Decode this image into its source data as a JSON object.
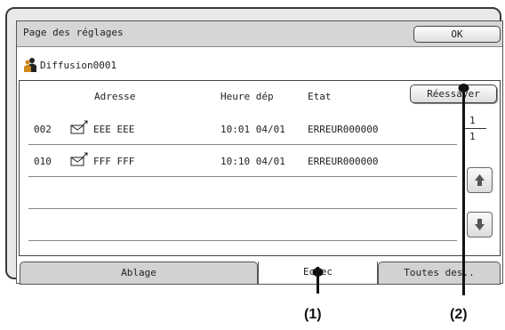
{
  "window": {
    "title": "Page des réglages",
    "ok_label": "OK"
  },
  "job": {
    "name": "Diffusion0001",
    "icon": "broadcast-people-icon"
  },
  "list": {
    "headers": {
      "address": "Adresse",
      "time": "Heure dép",
      "status": "Etat"
    },
    "retry_label": "Réessayer",
    "rows": [
      {
        "number": "002",
        "icon": "email-icon",
        "address": "EEE EEE",
        "time": "10:01 04/01",
        "status": "ERREUR000000"
      },
      {
        "number": "010",
        "icon": "email-icon",
        "address": "FFF FFF",
        "time": "10:10 04/01",
        "status": "ERREUR000000"
      }
    ],
    "page_current": "1",
    "page_total": "1"
  },
  "tabs": [
    {
      "label": "Ablage",
      "active": false
    },
    {
      "label": "Echec",
      "active": true
    },
    {
      "label": "Toutes des..",
      "active": false
    }
  ],
  "callouts": {
    "one": "(1)",
    "two": "(2)"
  },
  "colors": {
    "frame": "#e9e9e9",
    "titlebar": "#d6d6d6",
    "tab_inactive": "#d2d2d2"
  }
}
